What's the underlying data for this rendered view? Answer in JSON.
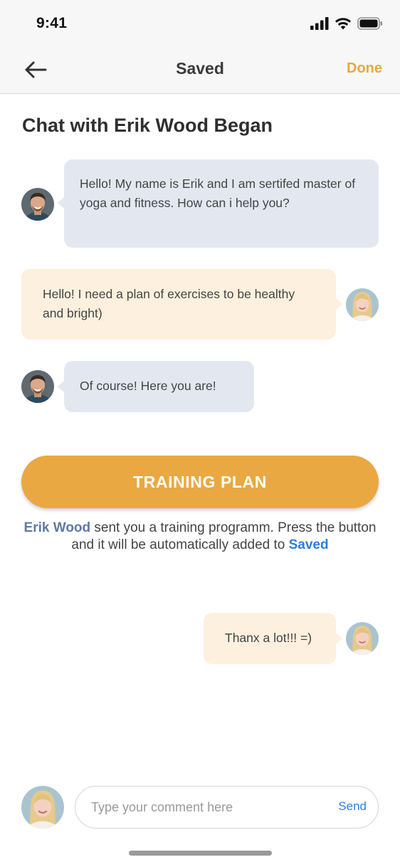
{
  "status_bar": {
    "time": "9:41"
  },
  "nav": {
    "title": "Saved",
    "done_label": "Done"
  },
  "chat": {
    "heading": "Chat with Erik Wood Began",
    "messages": [
      {
        "from": "trainer",
        "text": "Hello! My name is Erik and I am sertifed master of yoga and fitness. How can i help you?"
      },
      {
        "from": "user",
        "text": "Hello! I need a plan of exercises to be healthy and bright)"
      },
      {
        "from": "trainer",
        "text": "Of course! Here you are!"
      },
      {
        "from": "user",
        "text": "Thanx a lot!!! =)"
      }
    ]
  },
  "training": {
    "button_label": "TRAINING PLAN",
    "sender_name": "Erik Wood",
    "info_middle": " sent you a training programm. Press the button and it will be automatically added to ",
    "saved_link": "Saved"
  },
  "composer": {
    "placeholder": "Type your comment here",
    "send_label": "Send"
  },
  "colors": {
    "accent": "#eaa842",
    "link": "#2f7de1",
    "trainer_bubble": "#e3e8f0",
    "user_bubble": "#fdf0de"
  },
  "icons": [
    "signal-icon",
    "wifi-icon",
    "battery-icon",
    "back-arrow-icon"
  ]
}
